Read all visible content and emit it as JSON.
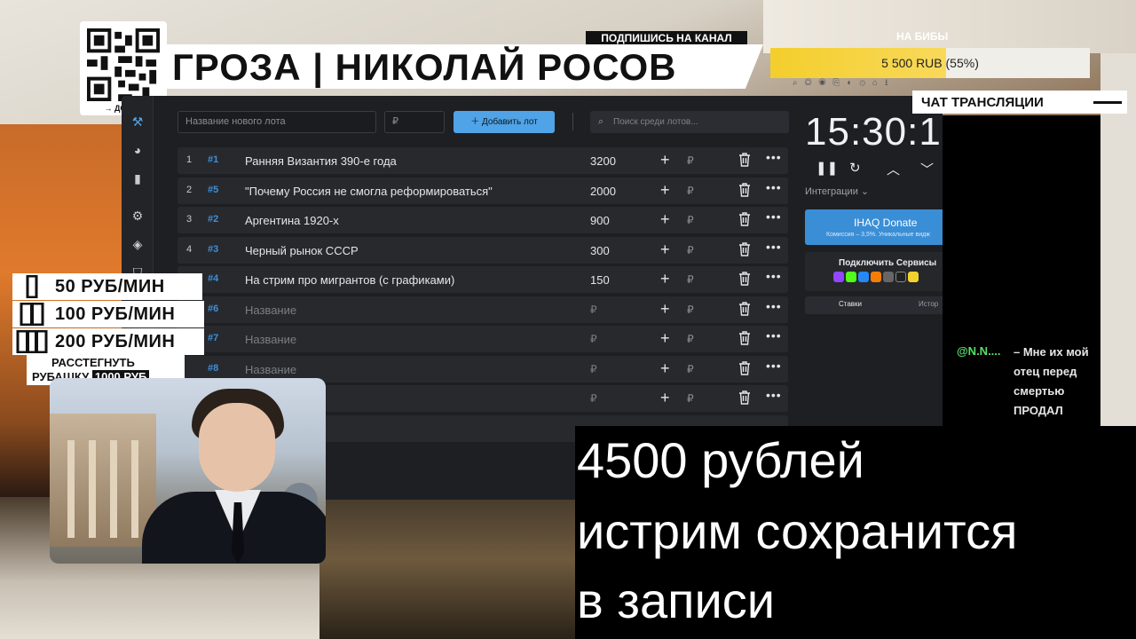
{
  "header": {
    "qr_label": "→ ДОНАТ",
    "title": "ГРОЗА | НИКОЛАЙ РОСОВ",
    "subscribe": "ПОДПИШИСЬ НА КАНАЛ"
  },
  "goal": {
    "label": "НА БИБЫ",
    "text": "5 500 RUB (55%)",
    "progress_percent": 55
  },
  "auction": {
    "lot_placeholder": "Название нового лота",
    "price_placeholder": "₽",
    "add_button": "Добавить лот",
    "search_placeholder": "Поиск среди лотов...",
    "lots": [
      {
        "num": "1",
        "id": "#1",
        "name": "Ранняя Византия 390-е года",
        "amount": "3200"
      },
      {
        "num": "2",
        "id": "#5",
        "name": "\"Почему Россия не смогла реформироваться\"",
        "amount": "2000"
      },
      {
        "num": "3",
        "id": "#2",
        "name": "Аргентина 1920-х",
        "amount": "900"
      },
      {
        "num": "4",
        "id": "#3",
        "name": "Черный рынок СССР",
        "amount": "300"
      },
      {
        "num": "5",
        "id": "#4",
        "name": "На стрим про мигрантов (с графиками)",
        "amount": "150"
      },
      {
        "num": "",
        "id": "#6",
        "name": "Название",
        "amount": "₽"
      },
      {
        "num": "",
        "id": "#7",
        "name": "Название",
        "amount": "₽"
      },
      {
        "num": "",
        "id": "#8",
        "name": "Название",
        "amount": "₽"
      },
      {
        "num": "",
        "id": "",
        "name": "",
        "amount": "₽"
      },
      {
        "num": "",
        "id": "",
        "name": "",
        "amount": ""
      }
    ],
    "row_currency": "₽",
    "timer": "15:30:1",
    "integrations": "Интеграции",
    "donate_title": "IHAQ Donate",
    "donate_sub": "Комиссия – 3,5%. Уникальные видж",
    "connect_title": "Подключить Сервисы",
    "tab_active": "Ставки",
    "tab_other": "Истор"
  },
  "chat": {
    "header": "ЧАТ ТРАНСЛЯЦИИ",
    "user": "@N.N....",
    "message": "– Мне их мой отец перед смертью ПРОДАЛ"
  },
  "price_list": {
    "p1": "50 РУБ/МИН",
    "p2": "100 РУБ/МИН",
    "p3": "200 РУБ/МИН",
    "shirt_l1": "РАССТЕГНУТЬ",
    "shirt_l2": "РУБАШКУ",
    "shirt_price": "1000 РУБ"
  },
  "subtitle": {
    "line1": "4500 рублей",
    "line2": "истрим сохранится",
    "line3": "в записи"
  }
}
